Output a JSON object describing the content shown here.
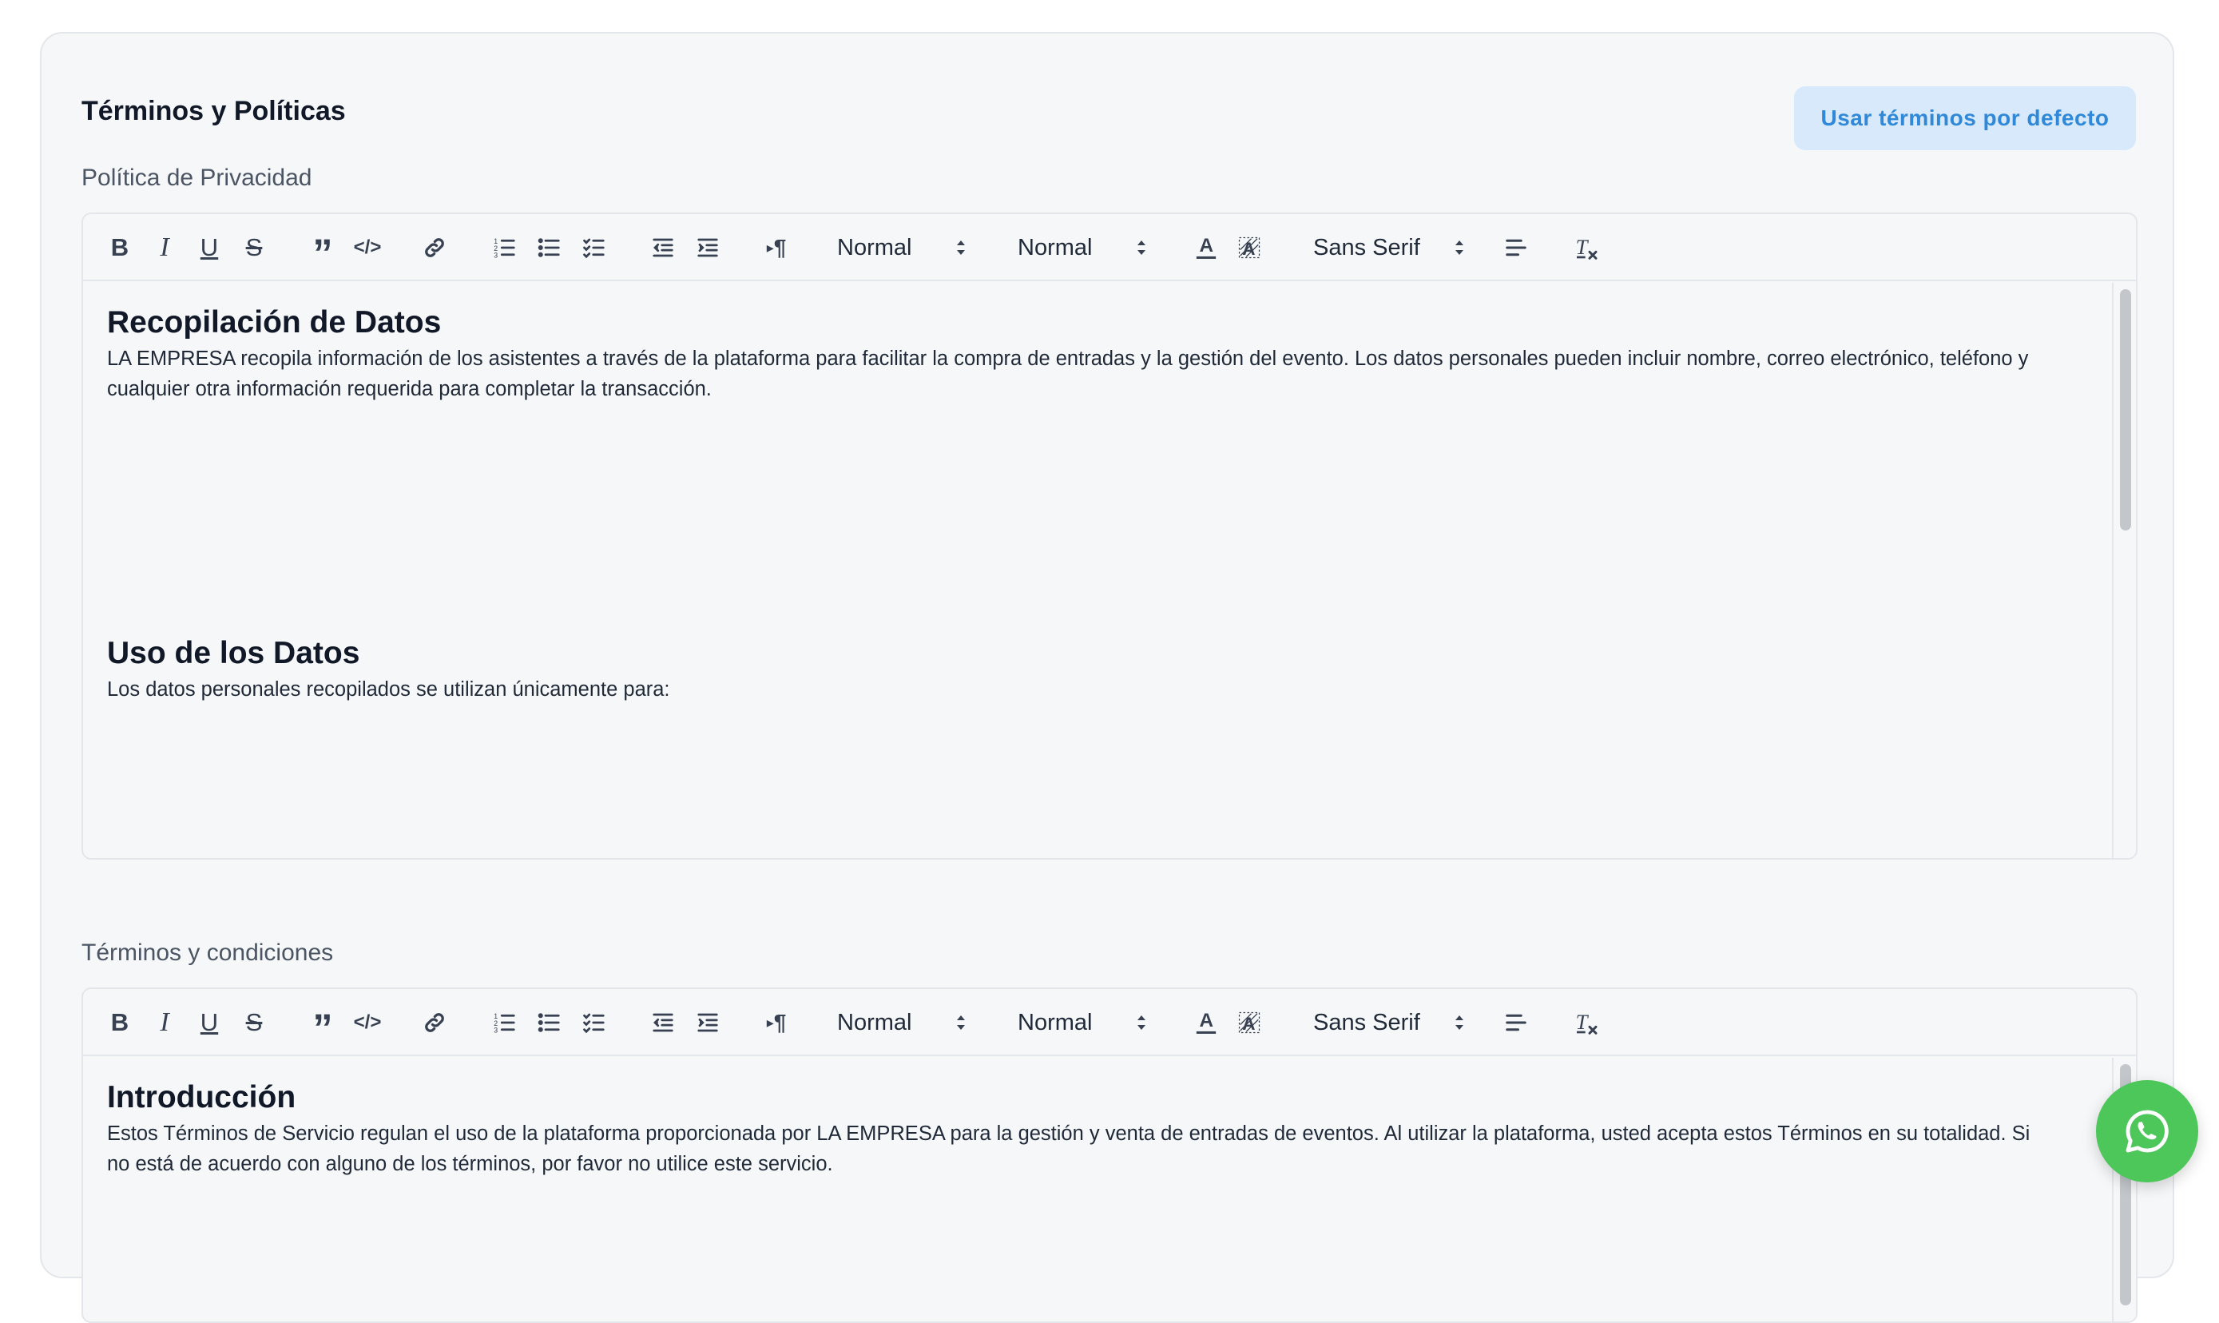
{
  "card": {
    "title": "Términos y Políticas",
    "default_button": "Usar términos por defecto"
  },
  "privacy": {
    "label": "Política de Privacidad",
    "toolbar": {
      "header_select": "Normal",
      "size_select": "Normal",
      "font_select": "Sans Serif"
    },
    "sections": [
      {
        "heading": "Recopilación de Datos",
        "body": "LA EMPRESA recopila información de los asistentes a través de la plataforma para facilitar la compra de entradas y la gestión del evento. Los datos personales pueden incluir nombre, correo electrónico, teléfono y cualquier otra información requerida para completar la transacción."
      },
      {
        "heading": "Uso de los Datos",
        "body": "Los datos personales recopilados se utilizan únicamente para:"
      }
    ]
  },
  "terms": {
    "label": "Términos y condiciones",
    "toolbar": {
      "header_select": "Normal",
      "size_select": "Normal",
      "font_select": "Sans Serif"
    },
    "sections": [
      {
        "heading": "Introducción",
        "body": "Estos Términos de Servicio regulan el uso de la plataforma proporcionada por LA EMPRESA para la gestión y venta de entradas de eventos. Al utilizar la plataforma, usted acepta estos Términos en su totalidad. Si no está de acuerdo con alguno de los términos, por favor no utilice este servicio."
      }
    ]
  },
  "colors": {
    "card_bg": "#f6f7f9",
    "button_bg": "#d7e9fb",
    "button_text": "#2f88d8",
    "whatsapp": "#4dc65a"
  },
  "icons": {
    "floating": "whatsapp-icon"
  }
}
